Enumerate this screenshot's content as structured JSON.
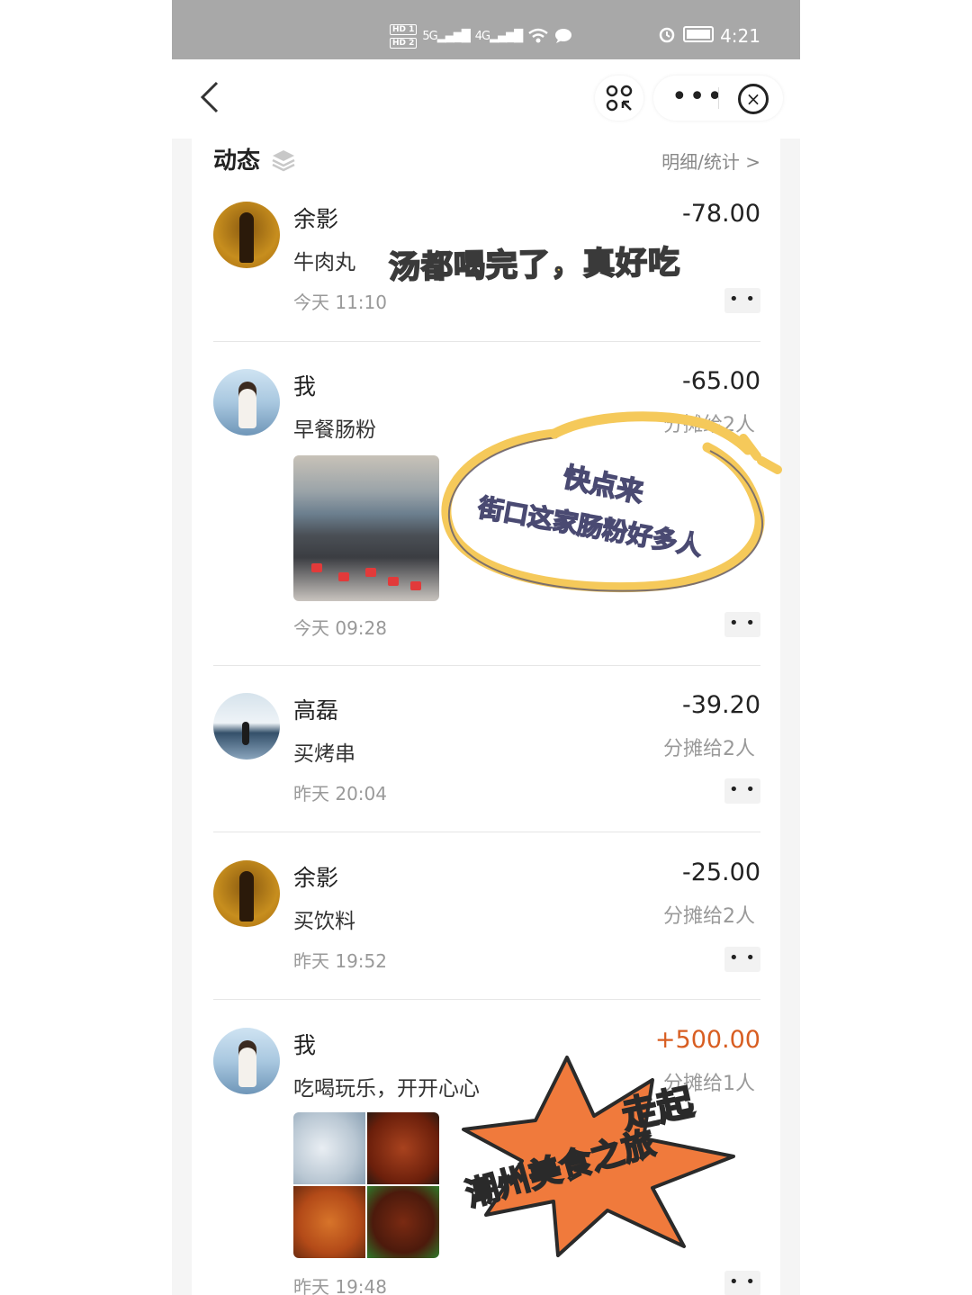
{
  "statusbar": {
    "hd1": "HD 1",
    "hd2": "HD 2",
    "sig1": "5G",
    "sig2": "4G",
    "time": "4:21"
  },
  "nav": {
    "back_icon": "chevron-left-icon",
    "more_label": "•••"
  },
  "section": {
    "title": "动态",
    "detail_link": "明细/统计 >"
  },
  "entries": [
    {
      "name": "余影",
      "desc": "牛肉丸",
      "time": "今天 11:10",
      "amount": "-78.00",
      "split": ""
    },
    {
      "name": "我",
      "desc": "早餐肠粉",
      "time": "今天 09:28",
      "amount": "-65.00",
      "split": "分摊给2人"
    },
    {
      "name": "高磊",
      "desc": "买烤串",
      "time": "昨天 20:04",
      "amount": "-39.20",
      "split": "分摊给2人"
    },
    {
      "name": "余影",
      "desc": "买饮料",
      "time": "昨天 19:52",
      "amount": "-25.00",
      "split": "分摊给2人"
    },
    {
      "name": "我",
      "desc": "吃喝玩乐，开开心心",
      "time": "昨天 19:48",
      "amount": "+500.00",
      "split": "分摊给1人"
    }
  ],
  "dots_label": "• •",
  "stickers": {
    "s1": "汤都喝完了，真好吃",
    "s2_line1": "快点来",
    "s2_line2": "街口这家肠粉好多人",
    "s3_line1": "走起",
    "s3_line2": "潮州美食之旅"
  },
  "colors": {
    "statusbar": "#a8a8a8",
    "positive_amount": "#d85e22",
    "sticker_yellow": "#f5d469",
    "burst_orange": "#f07a3c"
  }
}
